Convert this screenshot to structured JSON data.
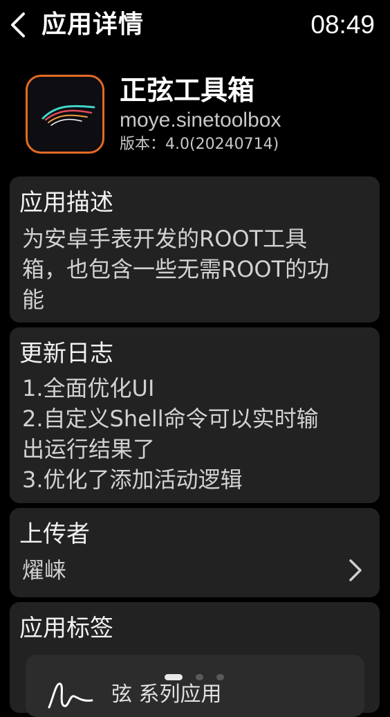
{
  "header": {
    "back_icon": "chevron-left-icon",
    "title": "应用详情",
    "clock": "08:49"
  },
  "app": {
    "icon": "sine-wave-logo",
    "name": "正弦工具箱",
    "package": "moye.sinetoolbox",
    "version_label": "版本：",
    "version_value": "4.0(20240714)",
    "accent_color": "#e46a22"
  },
  "description": {
    "title": "应用描述",
    "lines": [
      "为安卓手表开发的ROOT工具",
      "箱，也包含一些无需ROOT的功",
      "能"
    ]
  },
  "changelog": {
    "title": "更新日志",
    "lines": [
      "1.全面优化UI",
      "2.自定义Shell命令可以实时输",
      "出运行结果了",
      "3.优化了添加活动逻辑"
    ]
  },
  "uploader": {
    "title": "上传者",
    "name": "燿崃",
    "chevron_icon": "chevron-right-icon"
  },
  "tags": {
    "title": "应用标签",
    "items": [
      {
        "label": "弦 系列应用",
        "icon": "signature-icon"
      }
    ]
  },
  "pager": {
    "page_count": 3,
    "active_index": 0
  }
}
